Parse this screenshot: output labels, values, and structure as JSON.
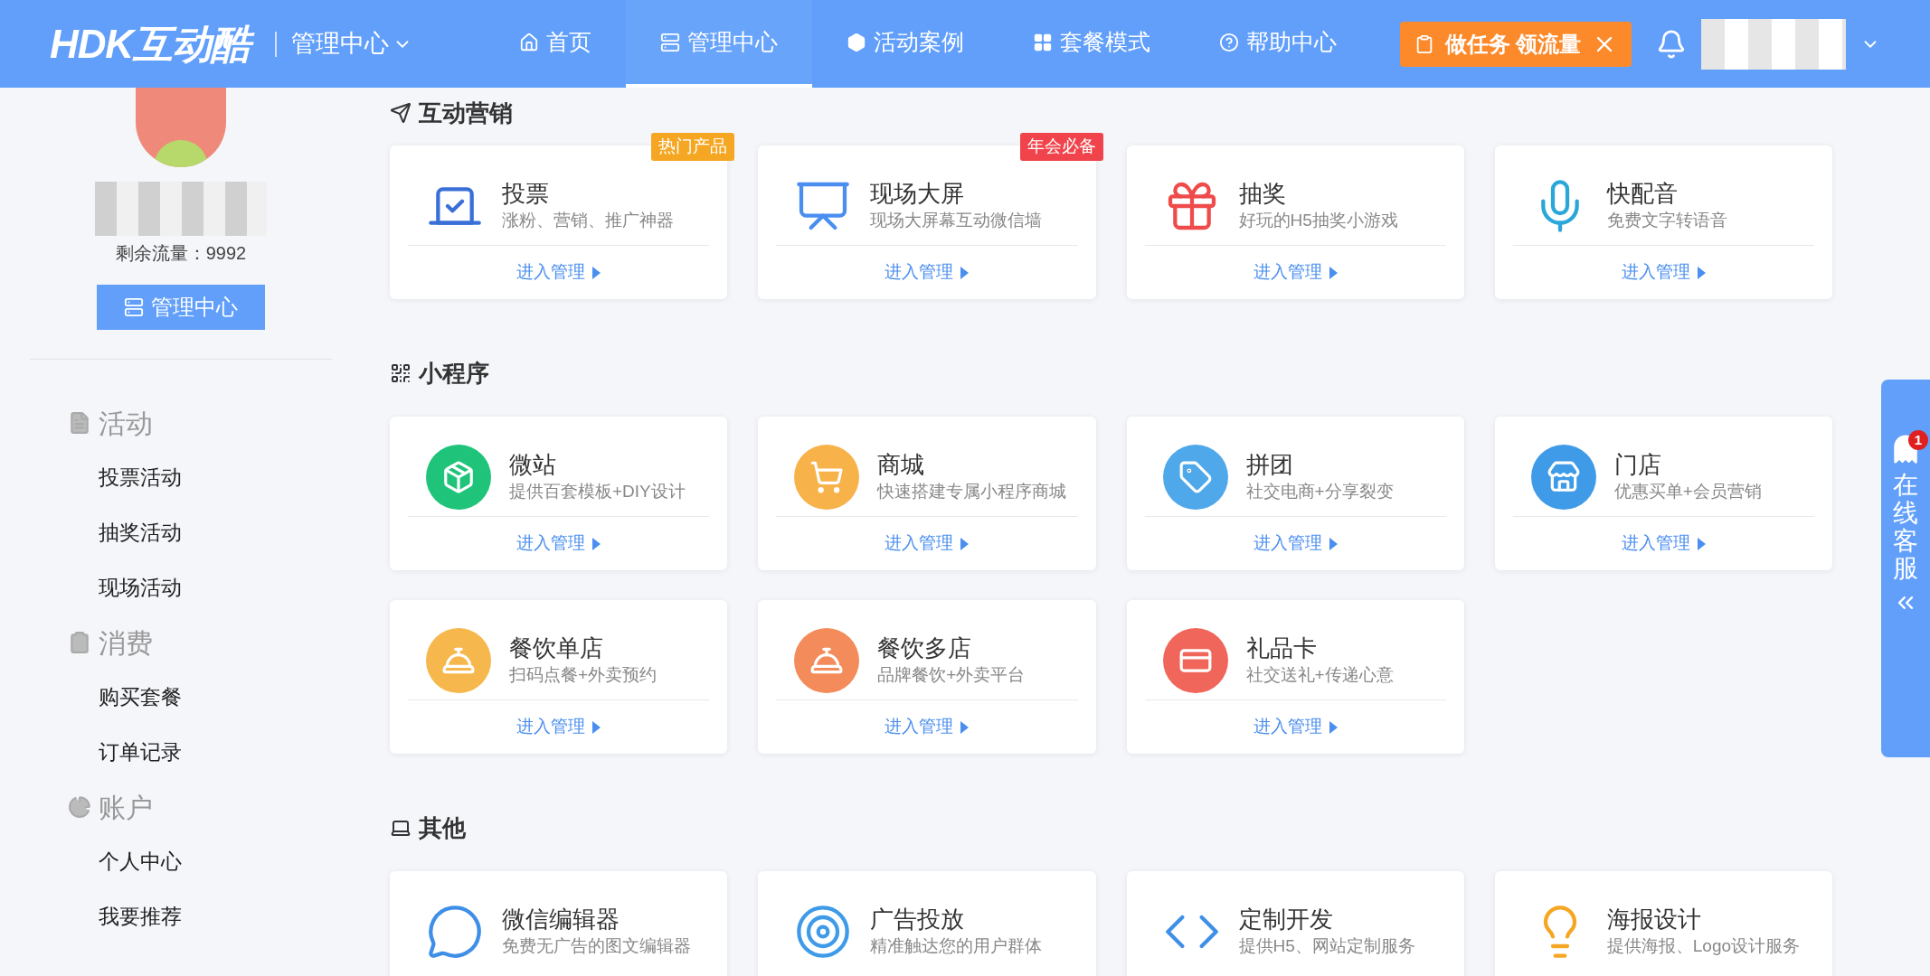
{
  "header": {
    "logo": "HDK互动酷",
    "center_label": "管理中心",
    "nav": [
      {
        "label": "首页",
        "selected": false
      },
      {
        "label": "管理中心",
        "selected": true
      },
      {
        "label": "活动案例",
        "selected": false
      },
      {
        "label": "套餐模式",
        "selected": false
      },
      {
        "label": "帮助中心",
        "selected": false
      }
    ],
    "promo": "做任务 领流量"
  },
  "sidebar": {
    "remaining": "剩余流量：9992",
    "button": "管理中心",
    "groups": [
      {
        "label": "活动",
        "children": [
          {
            "label": "投票活动"
          },
          {
            "label": "抽奖活动"
          },
          {
            "label": "现场活动"
          }
        ]
      },
      {
        "label": "消费",
        "children": [
          {
            "label": "购买套餐"
          },
          {
            "label": "订单记录"
          }
        ]
      },
      {
        "label": "账户",
        "children": [
          {
            "label": "个人中心"
          },
          {
            "label": "我要推荐"
          }
        ]
      }
    ]
  },
  "sections": [
    {
      "title": "互动营销",
      "cards": [
        {
          "title": "投票",
          "desc": "涨粉、营销、推广神器",
          "link": "进入管理",
          "badge": {
            "text": "热门产品",
            "color": "#f5a623"
          }
        },
        {
          "title": "现场大屏",
          "desc": "现场大屏幕互动微信墙",
          "link": "进入管理",
          "badge": {
            "text": "年会必备",
            "color": "#f0434b"
          }
        },
        {
          "title": "抽奖",
          "desc": "好玩的H5抽奖小游戏",
          "link": "进入管理"
        },
        {
          "title": "快配音",
          "desc": "免费文字转语音",
          "link": "进入管理"
        }
      ]
    },
    {
      "title": "小程序",
      "cards": [
        {
          "title": "微站",
          "desc": "提供百套模板+DIY设计",
          "link": "进入管理"
        },
        {
          "title": "商城",
          "desc": "快速搭建专属小程序商城",
          "link": "进入管理"
        },
        {
          "title": "拼团",
          "desc": "社交电商+分享裂变",
          "link": "进入管理"
        },
        {
          "title": "门店",
          "desc": "优惠买单+会员营销",
          "link": "进入管理"
        },
        {
          "title": "餐饮单店",
          "desc": "扫码点餐+外卖预约",
          "link": "进入管理"
        },
        {
          "title": "餐饮多店",
          "desc": "品牌餐饮+外卖平台",
          "link": "进入管理"
        },
        {
          "title": "礼品卡",
          "desc": "社交送礼+传递心意",
          "link": "进入管理"
        }
      ]
    },
    {
      "title": "其他",
      "cards": [
        {
          "title": "微信编辑器",
          "desc": "免费无广告的图文编辑器"
        },
        {
          "title": "广告投放",
          "desc": "精准触达您的用户群体"
        },
        {
          "title": "定制开发",
          "desc": "提供H5、网站定制服务"
        },
        {
          "title": "海报设计",
          "desc": "提供海报、Logo设计服务"
        }
      ]
    }
  ],
  "side_tab": {
    "label": "在线客服",
    "badge": "1"
  }
}
